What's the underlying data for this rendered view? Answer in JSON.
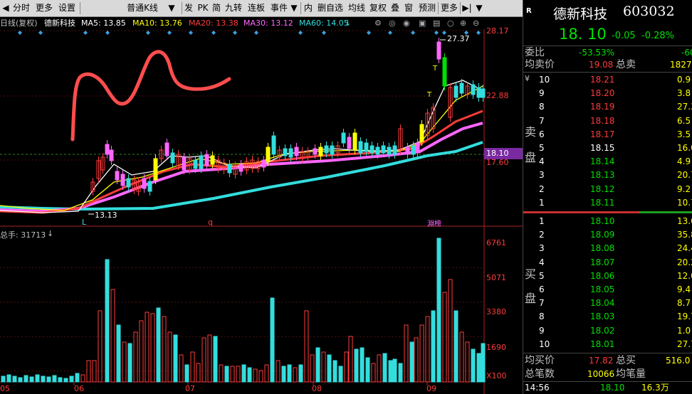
{
  "toolbar": {
    "items": [
      {
        "label": "分时"
      },
      {
        "label": "更多"
      },
      {
        "label": "设置"
      },
      {
        "label": "普通K线"
      },
      {
        "label": "发"
      },
      {
        "label": "PK"
      },
      {
        "label": "简"
      },
      {
        "label": "九转"
      },
      {
        "label": "连板"
      },
      {
        "label": "事件"
      },
      {
        "label": "内"
      },
      {
        "label": "删自选"
      },
      {
        "label": "均线"
      },
      {
        "label": "复权"
      },
      {
        "label": "叠"
      },
      {
        "label": "窗"
      },
      {
        "label": "预测"
      },
      {
        "label": "更多"
      }
    ]
  },
  "ma_bar": {
    "mode": "日线(复权)",
    "name": "德新科技",
    "ma5": "MA5: 13.85",
    "ma10": "MA10: 13.76",
    "ma20": "MA20: 13.38",
    "ma30": "MA30: 13.12",
    "ma60": "MA60: 14.05"
  },
  "colors": {
    "ma5": "#ffffff",
    "ma10": "#ffff00",
    "ma20": "#ff3b3b",
    "ma30": "#ff66ff",
    "ma60": "#33dddd",
    "up": "#ff3b3b",
    "down": "#33dddd"
  },
  "price_axis": {
    "labels": [
      "28.17",
      "22.88",
      "17.60"
    ],
    "current": "18.10",
    "high": "27.37",
    "low": "13.13"
  },
  "markers": {
    "l": "L",
    "q": "q",
    "dragon": "淵榜"
  },
  "volume": {
    "title": "总手: 31713",
    "labels": [
      "6761",
      "5071",
      "3380",
      "1690",
      "X100"
    ]
  },
  "x_axis": {
    "labels": [
      "05",
      "06",
      "07",
      "08",
      "09"
    ]
  },
  "quote": {
    "r_label": "R",
    "name": "德新科技",
    "code": "603032",
    "price": "18. 10",
    "change": "-0.05",
    "pct": "-0.28%",
    "weibi_label": "委比",
    "weibi": "-53.53%",
    "weibi_right": "-60",
    "avg_sell_label": "均卖价",
    "avg_sell": "19.08",
    "total_sell_label": "总卖",
    "total_sell": "1827",
    "sell_side": "卖",
    "sell_side2": "盘",
    "buy_side": "买",
    "buy_side2": "盘",
    "sells": [
      {
        "lvl": "10",
        "price": "18.21",
        "vol": "0.9"
      },
      {
        "lvl": "9",
        "price": "18.20",
        "vol": "3.8"
      },
      {
        "lvl": "8",
        "price": "18.19",
        "vol": "27.3"
      },
      {
        "lvl": "7",
        "price": "18.18",
        "vol": "6.5"
      },
      {
        "lvl": "6",
        "price": "18.17",
        "vol": "3.5"
      },
      {
        "lvl": "5",
        "price": "18.15",
        "vol": "16.0"
      },
      {
        "lvl": "4",
        "price": "18.14",
        "vol": "4.9"
      },
      {
        "lvl": "3",
        "price": "18.13",
        "vol": "20.7"
      },
      {
        "lvl": "2",
        "price": "18.12",
        "vol": "9.2"
      },
      {
        "lvl": "1",
        "price": "18.11",
        "vol": "10.7"
      }
    ],
    "buys": [
      {
        "lvl": "1",
        "price": "18.10",
        "vol": "13.0"
      },
      {
        "lvl": "2",
        "price": "18.09",
        "vol": "35.8"
      },
      {
        "lvl": "3",
        "price": "18.08",
        "vol": "24.4"
      },
      {
        "lvl": "4",
        "price": "18.07",
        "vol": "20.2"
      },
      {
        "lvl": "5",
        "price": "18.06",
        "vol": "12.0"
      },
      {
        "lvl": "6",
        "price": "18.05",
        "vol": "9.4"
      },
      {
        "lvl": "7",
        "price": "18.04",
        "vol": "8.7"
      },
      {
        "lvl": "8",
        "price": "18.03",
        "vol": "19.7"
      },
      {
        "lvl": "9",
        "price": "18.02",
        "vol": "1.0"
      },
      {
        "lvl": "10",
        "price": "18.01",
        "vol": "27.7"
      }
    ],
    "yen": "¥",
    "avg_buy_label": "均买价",
    "avg_buy": "17.82",
    "total_buy_label": "总买",
    "total_buy": "516.0",
    "total_trades_label": "总笔数",
    "total_trades": "10066",
    "avg_trade_label": "均笔量",
    "time": "14:56",
    "last_price": "18.10",
    "last_vol": "16.3万"
  }
}
